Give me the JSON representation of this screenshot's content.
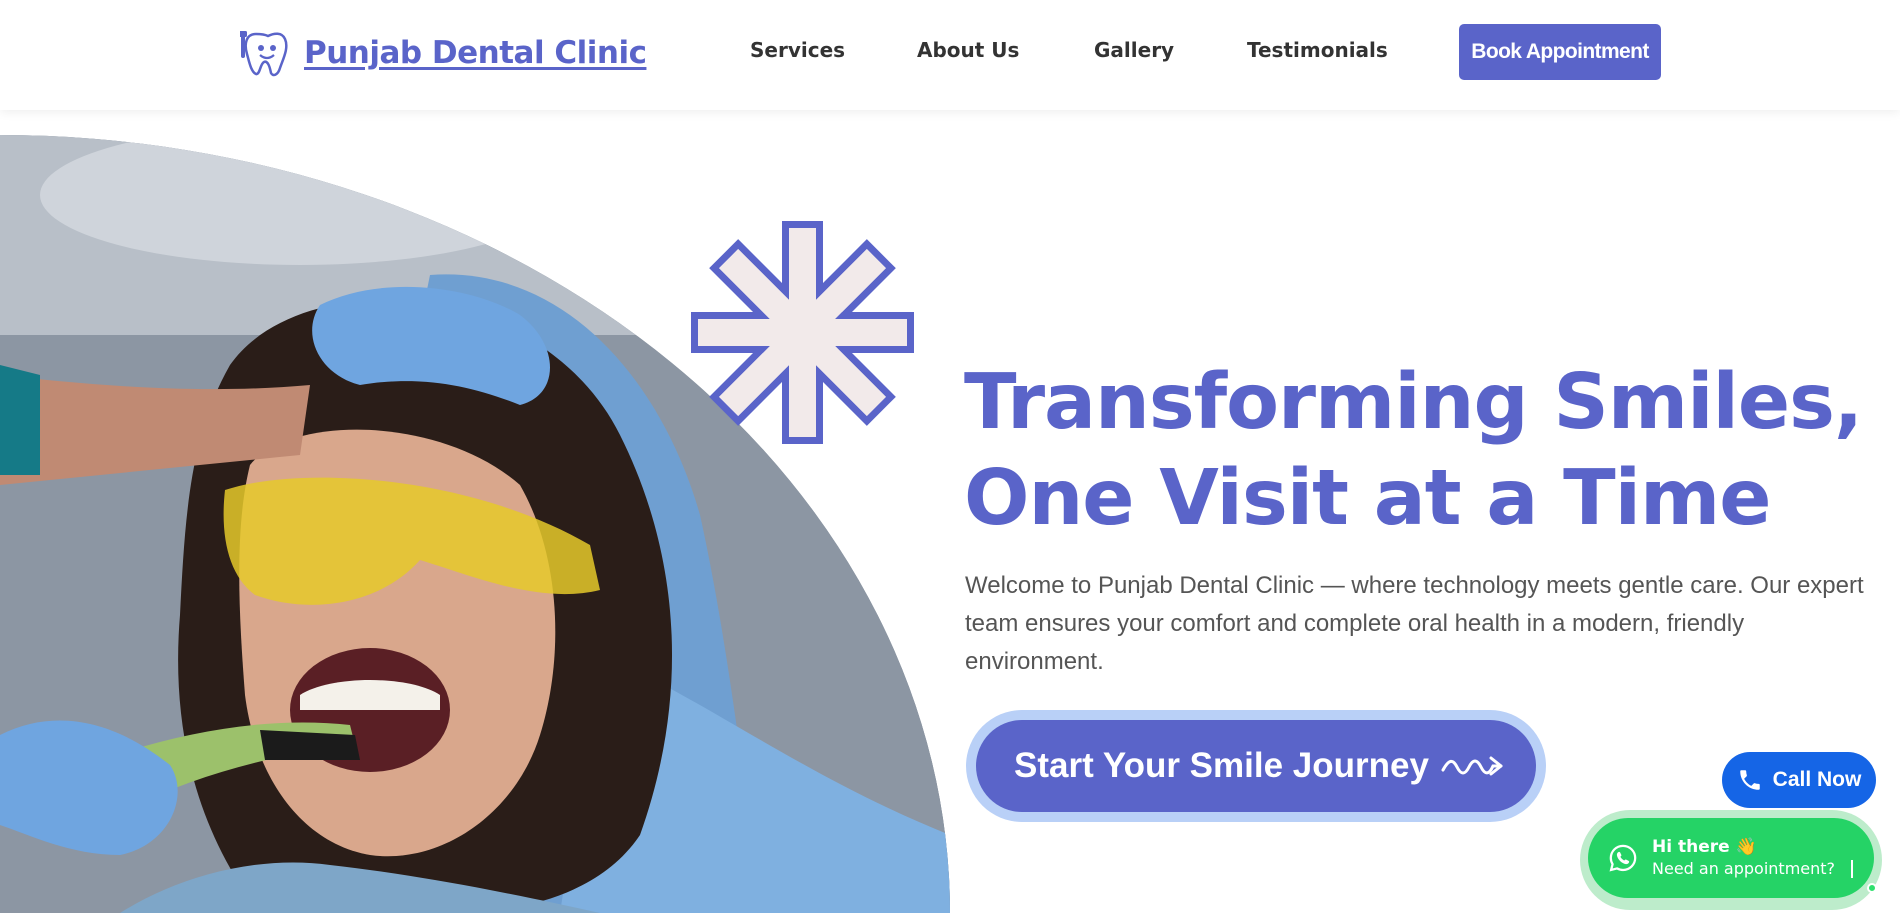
{
  "header": {
    "brand_name": "Punjab Dental Clinic",
    "logo_icon": "tooth-mascot-icon",
    "nav": [
      {
        "label": "Services"
      },
      {
        "label": "About Us"
      },
      {
        "label": "Gallery"
      },
      {
        "label": "Testimonials"
      }
    ],
    "cta_label": "Book Appointment"
  },
  "hero": {
    "headline_line1": "Transforming Smiles,",
    "headline_line2": "One Visit at a Time",
    "intro": "Welcome to Punjab Dental Clinic — where technology meets gentle care. Our expert team ensures your comfort and complete oral health in a modern, friendly environment.",
    "cta_label": "Start Your Smile Journey",
    "cta_icon": "squiggle-arrow-icon",
    "image_icon": "child-dental-exam-photo",
    "decoration_icon": "asterisk-star-icon"
  },
  "floating": {
    "call_label": "Call Now",
    "call_icon": "phone-icon",
    "whatsapp_title": "Hi there 👋",
    "whatsapp_subtitle": "Need an appointment?",
    "whatsapp_icon": "whatsapp-icon"
  },
  "colors": {
    "brand": "#5a64c9",
    "call": "#1565e6",
    "whatsapp": "#25d366",
    "cta_ring": "#b9d0f7"
  }
}
